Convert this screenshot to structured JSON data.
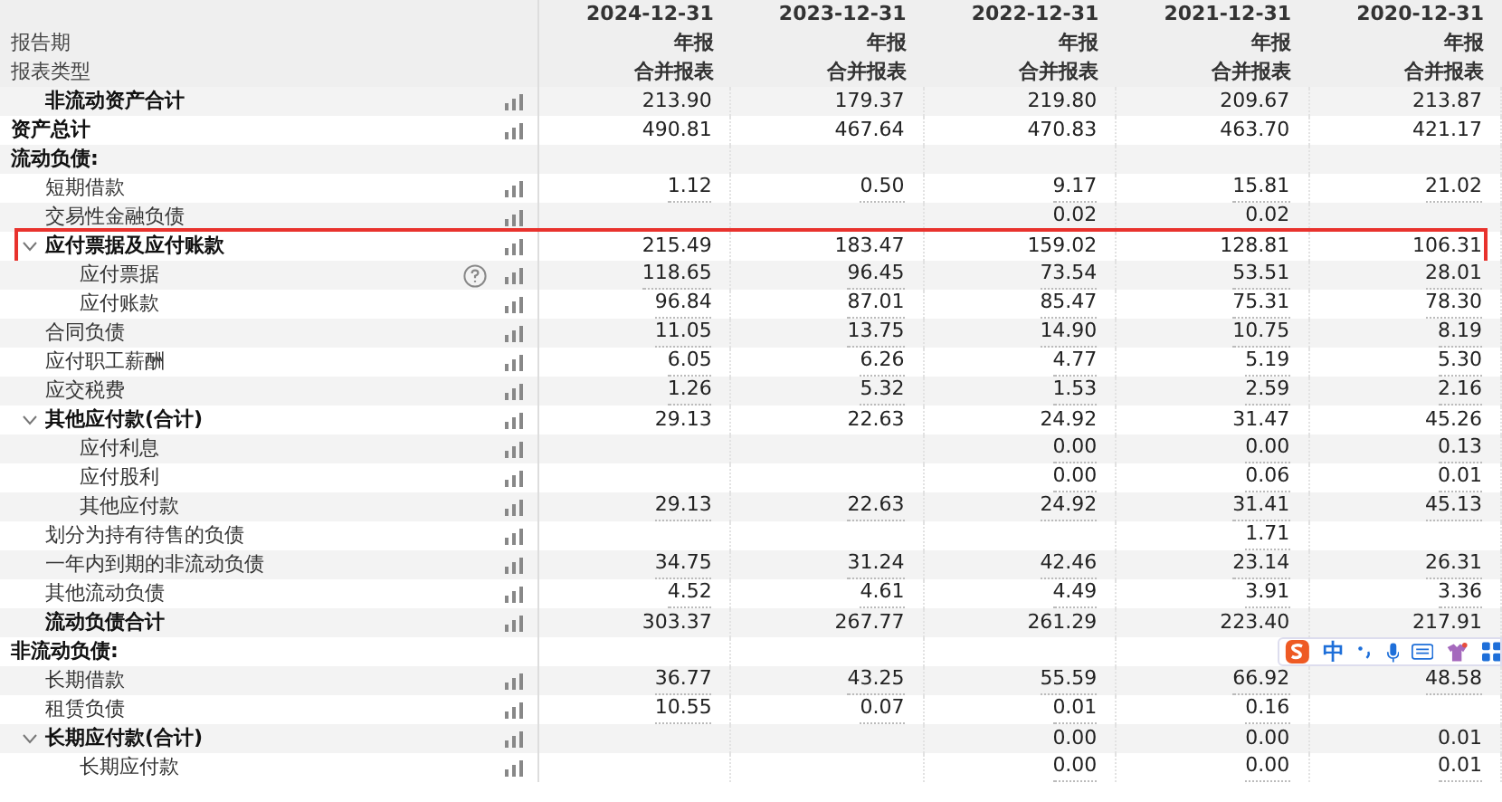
{
  "header": {
    "label_lines": [
      "报告期",
      "报表类型"
    ],
    "columns": [
      {
        "date": "2024-12-31",
        "period": "年报",
        "type": "合并报表"
      },
      {
        "date": "2023-12-31",
        "period": "年报",
        "type": "合并报表"
      },
      {
        "date": "2022-12-31",
        "period": "年报",
        "type": "合并报表"
      },
      {
        "date": "2021-12-31",
        "period": "年报",
        "type": "合并报表"
      },
      {
        "date": "2020-12-31",
        "period": "年报",
        "type": "合并报表"
      }
    ]
  },
  "rows": [
    {
      "kind": "subtotal",
      "label": "非流动资产合计",
      "values": {
        "column_1": "213.90",
        "column_2": "179.37",
        "column_3": "219.80",
        "column_4": "209.67",
        "column_5": "213.87"
      }
    },
    {
      "kind": "total",
      "label": "资产总计",
      "values": {
        "column_1": "490.81",
        "column_2": "467.64",
        "column_3": "470.83",
        "column_4": "463.70",
        "column_5": "421.17"
      }
    },
    {
      "kind": "section",
      "label": "流动负债:",
      "children": [
        {
          "kind": "item",
          "label": "短期借款",
          "values": {
            "column_1": "1.12",
            "column_2": "0.50",
            "column_3": "9.17",
            "column_4": "15.81",
            "column_5": "21.02"
          }
        },
        {
          "kind": "item",
          "label": "交易性金融负债",
          "values": {
            "column_3": "0.02",
            "column_4": "0.02"
          }
        },
        {
          "kind": "group",
          "label": "应付票据及应付账款",
          "expanded": true,
          "highlighted": true,
          "values": {
            "column_1": "215.49",
            "column_2": "183.47",
            "column_3": "159.02",
            "column_4": "128.81",
            "column_5": "106.31"
          },
          "children": [
            {
              "kind": "item",
              "label": "应付票据",
              "help": true,
              "values": {
                "column_1": "118.65",
                "column_2": "96.45",
                "column_3": "73.54",
                "column_4": "53.51",
                "column_5": "28.01"
              }
            },
            {
              "kind": "item",
              "label": "应付账款",
              "values": {
                "column_1": "96.84",
                "column_2": "87.01",
                "column_3": "85.47",
                "column_4": "75.31",
                "column_5": "78.30"
              }
            }
          ]
        },
        {
          "kind": "item",
          "label": "合同负债",
          "values": {
            "column_1": "11.05",
            "column_2": "13.75",
            "column_3": "14.90",
            "column_4": "10.75",
            "column_5": "8.19"
          }
        },
        {
          "kind": "item",
          "label": "应付职工薪酬",
          "values": {
            "column_1": "6.05",
            "column_2": "6.26",
            "column_3": "4.77",
            "column_4": "5.19",
            "column_5": "5.30"
          }
        },
        {
          "kind": "item",
          "label": "应交税费",
          "values": {
            "column_1": "1.26",
            "column_2": "5.32",
            "column_3": "1.53",
            "column_4": "2.59",
            "column_5": "2.16"
          }
        },
        {
          "kind": "group",
          "label": "其他应付款(合计)",
          "expanded": true,
          "values": {
            "column_1": "29.13",
            "column_2": "22.63",
            "column_3": "24.92",
            "column_4": "31.47",
            "column_5": "45.26"
          },
          "children": [
            {
              "kind": "item",
              "label": "应付利息",
              "values": {
                "column_3": "0.00",
                "column_4": "0.00",
                "column_5": "0.13"
              }
            },
            {
              "kind": "item",
              "label": "应付股利",
              "values": {
                "column_3": "0.00",
                "column_4": "0.06",
                "column_5": "0.01"
              }
            },
            {
              "kind": "item",
              "label": "其他应付款",
              "values": {
                "column_1": "29.13",
                "column_2": "22.63",
                "column_3": "24.92",
                "column_4": "31.41",
                "column_5": "45.13"
              }
            }
          ]
        },
        {
          "kind": "item",
          "label": "划分为持有待售的负债",
          "values": {
            "column_4": "1.71"
          }
        },
        {
          "kind": "item",
          "label": "一年内到期的非流动负债",
          "values": {
            "column_1": "34.75",
            "column_2": "31.24",
            "column_3": "42.46",
            "column_4": "23.14",
            "column_5": "26.31"
          }
        },
        {
          "kind": "item",
          "label": "其他流动负债",
          "values": {
            "column_1": "4.52",
            "column_2": "4.61",
            "column_3": "4.49",
            "column_4": "3.91",
            "column_5": "3.36"
          }
        },
        {
          "kind": "total",
          "label": "流动负债合计",
          "values": {
            "column_1": "303.37",
            "column_2": "267.77",
            "column_3": "261.29",
            "column_4": "223.40",
            "column_5": "217.91"
          }
        }
      ]
    },
    {
      "kind": "section",
      "label": "非流动负债:",
      "children": [
        {
          "kind": "item",
          "label": "长期借款",
          "values": {
            "column_1": "36.77",
            "column_2": "43.25",
            "column_3": "55.59",
            "column_4": "66.92",
            "column_5": "48.58"
          }
        },
        {
          "kind": "item",
          "label": "租赁负债",
          "values": {
            "column_1": "10.55",
            "column_2": "0.07",
            "column_3": "0.01",
            "column_4": "0.16"
          }
        },
        {
          "kind": "group",
          "label": "长期应付款(合计)",
          "expanded": true,
          "values": {
            "column_3": "0.00",
            "column_4": "0.00",
            "column_5": "0.01"
          },
          "children": [
            {
              "kind": "item",
              "label": "长期应付款",
              "values": {
                "column_3": "0.00",
                "column_4": "0.00",
                "column_5": "0.01"
              }
            }
          ]
        }
      ]
    }
  ],
  "ime_toolbar": {
    "label": "中"
  }
}
